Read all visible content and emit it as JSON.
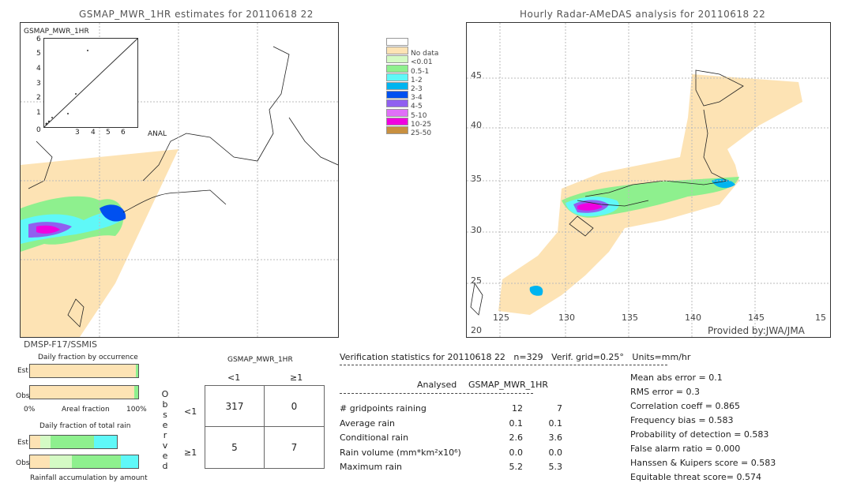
{
  "left_map": {
    "title": "GSMAP_MWR_1HR estimates for 20110618 22",
    "inset_ylabel": "GSMAP_MWR_1HR",
    "inset_xlabel": "ANAL",
    "inset_ticks": [
      "0",
      "1",
      "2",
      "3",
      "4",
      "5",
      "6"
    ],
    "satellite": "DMSP-F17/SSMIS"
  },
  "right_map": {
    "title": "Hourly Radar-AMeDAS analysis for 20110618 22",
    "lat_labels": [
      "45",
      "40",
      "35",
      "30",
      "25",
      "20"
    ],
    "lon_labels": [
      "125",
      "130",
      "135",
      "140",
      "145",
      "15"
    ],
    "credit": "Provided by:JWA/JMA"
  },
  "legend": [
    {
      "label": "",
      "color": "#ffffff"
    },
    {
      "label": "No data",
      "color": "#fde3b4"
    },
    {
      "label": "<0.01",
      "color": "#d4fac4"
    },
    {
      "label": "0.5-1",
      "color": "#8ef08e"
    },
    {
      "label": "1-2",
      "color": "#5ff8f8"
    },
    {
      "label": "2-3",
      "color": "#00b4f0"
    },
    {
      "label": "3-4",
      "color": "#0050f0"
    },
    {
      "label": "4-5",
      "color": "#9060f0"
    },
    {
      "label": "5-10",
      "color": "#e070f8"
    },
    {
      "label": "10-25",
      "color": "#f000e0"
    },
    {
      "label": "25-50",
      "color": "#c89040"
    }
  ],
  "occurrence": {
    "title": "Daily fraction by occurrence",
    "est_label": "Est",
    "obs_label": "Obs",
    "axis_left": "0%",
    "axis_mid": "Areal fraction",
    "axis_right": "100%",
    "est_fraction_raining": 0.021,
    "obs_fraction_raining": 0.036
  },
  "total_rain": {
    "title": "Daily fraction of total rain",
    "est_label": "Est",
    "obs_label": "Obs",
    "footer": "Rainfall accumulation by amount"
  },
  "contingency": {
    "title": "GSMAP_MWR_1HR",
    "col_headers": [
      "<1",
      "≥1"
    ],
    "row_headers": [
      "<1",
      "≥1"
    ],
    "side_label": "Observed",
    "cells": [
      [
        "317",
        "0"
      ],
      [
        "5",
        "7"
      ]
    ]
  },
  "stats": {
    "header": "Verification statistics for 20110618 22   n=329   Verif. grid=0.25°   Units=mm/hr",
    "col_analysed": "Analysed",
    "col_est": "GSMAP_MWR_1HR",
    "rows": [
      {
        "label": "# gridpoints raining",
        "a": "12",
        "e": "7"
      },
      {
        "label": "Average rain",
        "a": "0.1",
        "e": "0.1"
      },
      {
        "label": "Conditional rain",
        "a": "2.6",
        "e": "3.6"
      },
      {
        "label": "Rain volume (mm*km²x10⁶)",
        "a": "0.0",
        "e": "0.0"
      },
      {
        "label": "Maximum rain",
        "a": "5.2",
        "e": "5.3"
      }
    ],
    "scores": [
      "Mean abs error = 0.1",
      "RMS error = 0.3",
      "Correlation coeff = 0.865",
      "Frequency bias = 0.583",
      "Probability of detection = 0.583",
      "False alarm ratio = 0.000",
      "Hanssen & Kuipers score = 0.583",
      "Equitable threat score= 0.574"
    ]
  }
}
